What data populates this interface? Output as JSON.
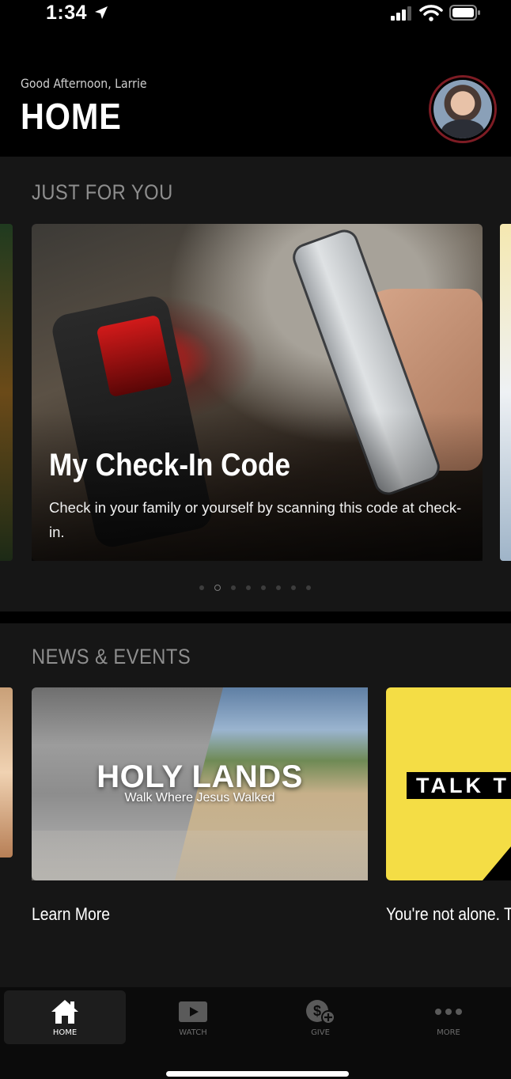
{
  "status_bar": {
    "time": "1:34"
  },
  "header": {
    "greeting": "Good Afternoon,  Larrie",
    "title": "HOME"
  },
  "just_for_you": {
    "heading": "JUST FOR YOU",
    "card": {
      "title": "My Check-In Code",
      "description": "Check in your family or yourself by scanning this code at check-in."
    },
    "pagination": {
      "count": 8,
      "active_index": 1
    }
  },
  "news_events": {
    "heading": "NEWS & EVENTS",
    "cards": [
      {
        "image_title": "HOLY LANDS",
        "image_subtitle": "Walk Where Jesus Walked",
        "label": "Learn More"
      },
      {
        "image_title": "TALK T",
        "label": "You're not alone. T"
      }
    ]
  },
  "nav": {
    "items": [
      {
        "label": "HOME",
        "icon": "home-icon",
        "active": true
      },
      {
        "label": "WATCH",
        "icon": "play-icon",
        "active": false
      },
      {
        "label": "GIVE",
        "icon": "give-icon",
        "active": false
      },
      {
        "label": "MORE",
        "icon": "more-icon",
        "active": false
      }
    ]
  },
  "colors": {
    "accent_ring": "#7d1c24",
    "talk_yellow": "#f4dd45",
    "section_bg": "#161616"
  }
}
